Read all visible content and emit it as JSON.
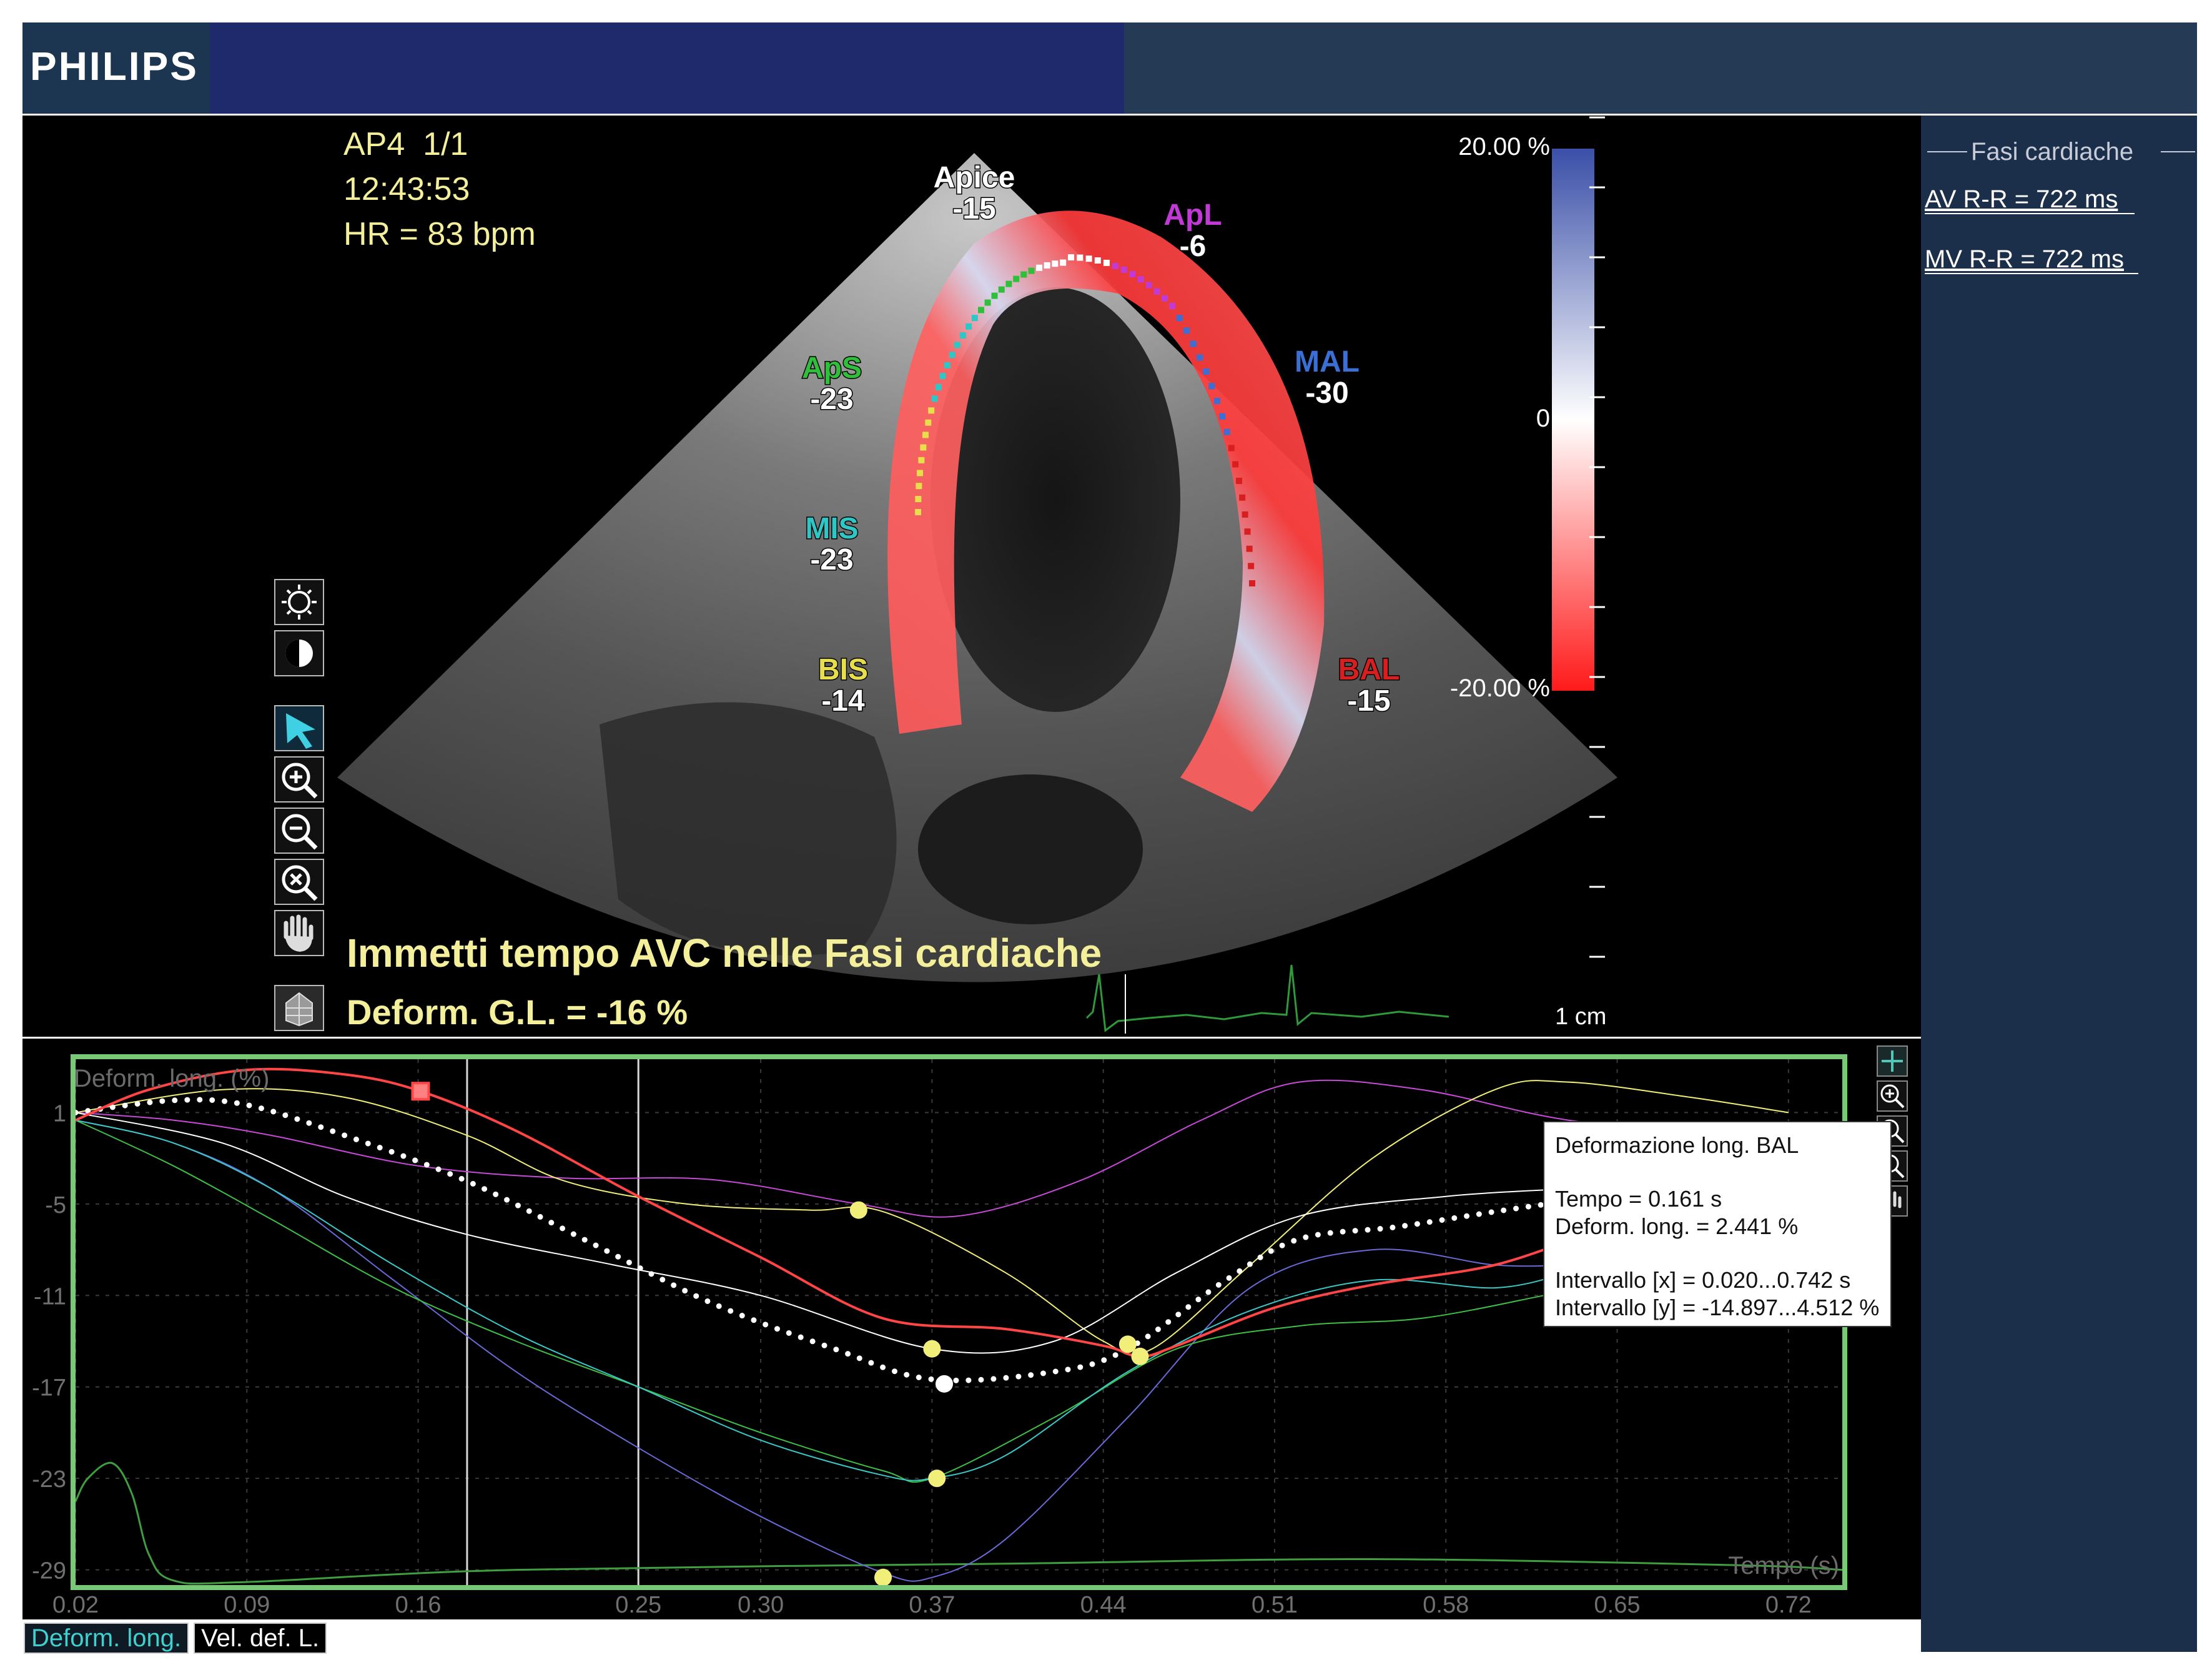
{
  "app": {
    "brand": "PHILIPS"
  },
  "image_overlay": {
    "view_label": "AP4  1/1",
    "time": "12:43:53",
    "heart_rate": "HR = 83 bpm",
    "scale_max": "20.00 %",
    "scale_zero": "0",
    "scale_min": "-20.00 %",
    "scale_unit": "1 cm",
    "message": "Immetti tempo AVC nelle Fasi cardiache",
    "global_strain": "Deform. G.L. = -16 %",
    "colors": {
      "positive": "#3a4fa8",
      "negative": "#ff1a1a",
      "text": "#f3ef9a"
    }
  },
  "segments": [
    {
      "name": "Apice",
      "value": "-15",
      "color": "#ffffff"
    },
    {
      "name": "ApL",
      "value": "-6",
      "color": "#c23ad6"
    },
    {
      "name": "MAL",
      "value": "-30",
      "color": "#3a6fd6"
    },
    {
      "name": "ApS",
      "value": "-23",
      "color": "#2fbf3a"
    },
    {
      "name": "MIS",
      "value": "-23",
      "color": "#2fc6c6"
    },
    {
      "name": "BIS",
      "value": "-14",
      "color": "#e6de4a"
    },
    {
      "name": "BAL",
      "value": "-15",
      "color": "#d81f1f"
    }
  ],
  "right_panel": {
    "title": "Fasi cardiache",
    "av_rr": "AV R-R = 722 ms",
    "mv_rr": "MV R-R = 722 ms"
  },
  "tools": [
    "brightness-icon",
    "contrast-icon",
    "pointer-icon",
    "zoom-in-icon",
    "zoom-out-icon",
    "zoom-reset-icon",
    "pan-hand-icon",
    "bullseye-icon"
  ],
  "tooltip": {
    "title": "Deformazione long. BAL",
    "tempo": "Tempo = 0.161 s",
    "deform": "Deform. long. = 2.441 %",
    "interval_x": "Intervallo [x] = 0.020...0.742 s",
    "interval_y": "Intervallo [y] = -14.897...4.512 %"
  },
  "tabs": {
    "active": "Deform. long.",
    "other": "Vel. def. L."
  },
  "chart_data": {
    "type": "line",
    "ylabel": "Deform. long. (%)",
    "xlabel": "Tempo (s)",
    "x_ticks": [
      0.02,
      0.09,
      0.16,
      0.25,
      0.3,
      0.37,
      0.44,
      0.51,
      0.58,
      0.65,
      0.72
    ],
    "y_ticks": [
      1,
      -5,
      -11,
      -17,
      -23,
      -29
    ],
    "xlim": [
      0.02,
      0.742
    ],
    "ylim": [
      -30,
      4.5
    ],
    "vertical_markers": [
      0.18,
      0.25
    ],
    "series": [
      {
        "name": "BAL",
        "color": "#ff4545",
        "width": 4,
        "dotted": false,
        "x": [
          0.02,
          0.05,
          0.09,
          0.13,
          0.161,
          0.2,
          0.25,
          0.3,
          0.35,
          0.4,
          0.44,
          0.455,
          0.47,
          0.51,
          0.55,
          0.6,
          0.64
        ],
        "y": [
          0.5,
          2.5,
          3.8,
          3.5,
          2.4,
          -0.2,
          -4.5,
          -8.5,
          -12.5,
          -13.2,
          -14.3,
          -15.0,
          -14.3,
          -11.8,
          -10.3,
          -9.0,
          -6.8
        ]
      },
      {
        "name": "ApL",
        "color": "#c84ad8",
        "width": 2,
        "dotted": false,
        "x": [
          0.02,
          0.06,
          0.1,
          0.16,
          0.22,
          0.28,
          0.34,
          0.38,
          0.43,
          0.48,
          0.52,
          0.57,
          0.63,
          0.7,
          0.72
        ],
        "y": [
          1.0,
          0.5,
          -0.5,
          -2.5,
          -3.3,
          -3.4,
          -5.0,
          -5.8,
          -3.5,
          0.5,
          3.0,
          2.5,
          0.5,
          -0.6,
          -0.9
        ]
      },
      {
        "name": "BIS",
        "color": "#f2ee7a",
        "width": 2,
        "dotted": false,
        "x": [
          0.02,
          0.08,
          0.13,
          0.18,
          0.22,
          0.27,
          0.32,
          0.35,
          0.4,
          0.44,
          0.46,
          0.5,
          0.55,
          0.6,
          0.63,
          0.68,
          0.72
        ],
        "y": [
          1.0,
          2.5,
          2.0,
          -0.5,
          -3.5,
          -5.0,
          -5.4,
          -5.5,
          -9.5,
          -14.0,
          -14.5,
          -9.0,
          -2.0,
          2.5,
          3.0,
          2.0,
          1.0
        ]
      },
      {
        "name": "Apice",
        "color": "#ffffff",
        "width": 2,
        "dotted": false,
        "x": [
          0.02,
          0.08,
          0.13,
          0.18,
          0.24,
          0.3,
          0.37,
          0.42,
          0.47,
          0.52,
          0.58,
          0.63
        ],
        "y": [
          1.0,
          -1.0,
          -4.5,
          -7.0,
          -9.0,
          -11.0,
          -14.5,
          -14.0,
          -9.5,
          -5.8,
          -4.5,
          -4.0
        ]
      },
      {
        "name": "MIS",
        "color": "#3ac8c8",
        "width": 2,
        "dotted": false,
        "x": [
          0.02,
          0.06,
          0.1,
          0.15,
          0.2,
          0.25,
          0.3,
          0.35,
          0.37,
          0.4,
          0.45,
          0.5,
          0.55,
          0.6,
          0.63
        ],
        "y": [
          0.5,
          -1.0,
          -4.0,
          -9.0,
          -13.5,
          -17.0,
          -20.5,
          -22.8,
          -23.0,
          -21.5,
          -16.0,
          -12.0,
          -10.0,
          -10.5,
          -9.5
        ]
      },
      {
        "name": "ApS",
        "color": "#3fbf45",
        "width": 2,
        "dotted": false,
        "x": [
          0.02,
          0.06,
          0.1,
          0.15,
          0.2,
          0.25,
          0.3,
          0.35,
          0.37,
          0.42,
          0.47,
          0.52,
          0.57,
          0.62
        ],
        "y": [
          0.5,
          -2.5,
          -6.0,
          -10.5,
          -14.0,
          -17.0,
          -20.0,
          -22.5,
          -23.0,
          -19.0,
          -14.5,
          -13.0,
          -12.5,
          -11.0
        ]
      },
      {
        "name": "MAL",
        "color": "#6a6ad8",
        "width": 2,
        "dotted": false,
        "x": [
          0.02,
          0.06,
          0.1,
          0.15,
          0.2,
          0.25,
          0.3,
          0.35,
          0.37,
          0.4,
          0.45,
          0.5,
          0.55,
          0.6,
          0.63
        ],
        "y": [
          0.5,
          -1.0,
          -4.0,
          -10.0,
          -16.0,
          -21.0,
          -25.5,
          -29.2,
          -29.5,
          -27.0,
          -19.0,
          -10.5,
          -8.0,
          -9.0,
          -9.0
        ]
      },
      {
        "name": "Media",
        "color": "#ffffff",
        "width": 6,
        "dotted": true,
        "x": [
          0.02,
          0.06,
          0.09,
          0.13,
          0.18,
          0.23,
          0.28,
          0.33,
          0.37,
          0.42,
          0.45,
          0.49,
          0.52,
          0.56,
          0.6,
          0.63
        ],
        "y": [
          1.0,
          1.8,
          1.5,
          -0.5,
          -3.5,
          -7.5,
          -11.5,
          -14.5,
          -16.5,
          -16.0,
          -14.5,
          -10.0,
          -7.3,
          -6.5,
          -5.5,
          -4.8
        ]
      },
      {
        "name": "ECG",
        "color": "#3f9e3f",
        "width": 3,
        "dotted": false,
        "x": [
          0.02,
          0.025,
          0.035,
          0.043,
          0.05,
          0.06,
          0.09,
          0.2,
          0.4,
          0.55,
          0.7,
          0.742
        ],
        "y": [
          -24.5,
          -23.0,
          -22.0,
          -24.0,
          -28.0,
          -29.7,
          -29.8,
          -29.0,
          -28.6,
          -28.3,
          -28.7,
          -29.0
        ]
      }
    ],
    "markers": [
      {
        "x": 0.161,
        "y": 2.4,
        "color": "#ff4545",
        "shape": "square"
      },
      {
        "x": 0.34,
        "y": -5.4,
        "color": "#f2ee7a",
        "shape": "circle"
      },
      {
        "x": 0.37,
        "y": -14.5,
        "color": "#f2ee7a",
        "shape": "circle"
      },
      {
        "x": 0.375,
        "y": -16.8,
        "color": "#ffffff",
        "shape": "circle"
      },
      {
        "x": 0.372,
        "y": -23.0,
        "color": "#f2ee7a",
        "shape": "circle"
      },
      {
        "x": 0.35,
        "y": -29.5,
        "color": "#f2ee7a",
        "shape": "circle"
      },
      {
        "x": 0.45,
        "y": -14.2,
        "color": "#f2ee7a",
        "shape": "circle"
      },
      {
        "x": 0.455,
        "y": -15.0,
        "color": "#f2ee7a",
        "shape": "circle"
      }
    ]
  }
}
